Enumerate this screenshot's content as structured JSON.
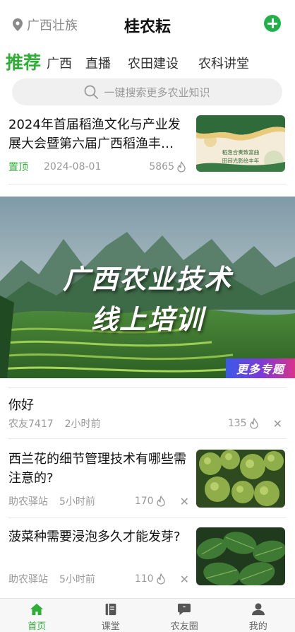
{
  "header": {
    "location": "广西壮族",
    "app_title": "桂农耘",
    "location_icon": "location-pin-icon",
    "add_icon": "plus-circle-icon"
  },
  "tabs": [
    {
      "label": "推荐",
      "active": true
    },
    {
      "label": "广西",
      "active": false
    },
    {
      "label": "直播",
      "active": false
    },
    {
      "label": "农田建设",
      "active": false
    },
    {
      "label": "农科讲堂",
      "active": false
    }
  ],
  "search": {
    "placeholder": "一键搜索更多农业知识",
    "icon": "search-icon"
  },
  "featured": {
    "title": "2024年首届稻渔文化与产业发展大会暨第六届广西稻渔丰…",
    "pin_label": "置顶",
    "date": "2024-08-01",
    "views": "5865",
    "thumb_line1": "稻渔合奏致富曲",
    "thumb_line2": "田间光影绘丰年"
  },
  "banner": {
    "line1": "广西农业技术",
    "line2": "线上培训",
    "more_label": "更多专题"
  },
  "posts": [
    {
      "title": "你好",
      "author": "农友7417",
      "time": "2小时前",
      "views": "135"
    },
    {
      "title": "西兰花的细节管理技术有哪些需注意的?",
      "author": "助农驿站",
      "time": "5小时前",
      "views": "170"
    },
    {
      "title": "菠菜种需要浸泡多久才能发芽?",
      "author": "助农驿站",
      "time": "5小时前",
      "views": "110"
    }
  ],
  "nav": [
    {
      "label": "首页",
      "icon": "home-icon",
      "active": true
    },
    {
      "label": "课堂",
      "icon": "book-icon",
      "active": false
    },
    {
      "label": "农友圈",
      "icon": "chat-bubble-icon",
      "active": false
    },
    {
      "label": "我的",
      "icon": "user-icon",
      "active": false
    }
  ],
  "colors": {
    "accent": "#2fae38",
    "plus": "#22b04b",
    "muted": "#999999"
  }
}
